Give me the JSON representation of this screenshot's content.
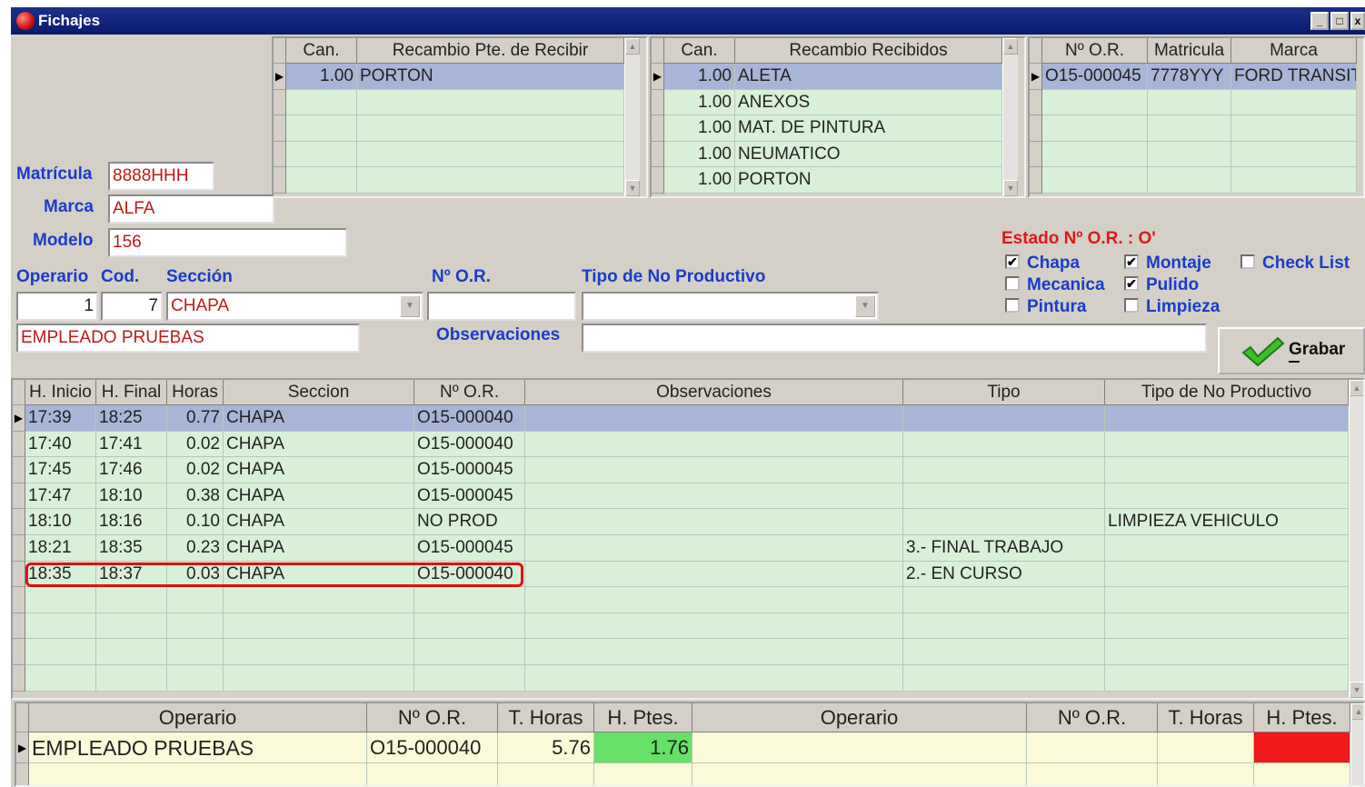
{
  "window": {
    "title": "Fichajes"
  },
  "pending_grid": {
    "headers": [
      "Can.",
      "Recambio Pte. de Recibir"
    ],
    "rows": [
      [
        "1.00",
        "PORTON"
      ]
    ]
  },
  "received_grid": {
    "headers": [
      "Can.",
      "Recambio Recibidos"
    ],
    "rows": [
      [
        "1.00",
        "ALETA"
      ],
      [
        "1.00",
        "ANEXOS"
      ],
      [
        "1.00",
        "MAT. DE PINTURA"
      ],
      [
        "1.00",
        "NEUMATICO"
      ],
      [
        "1.00",
        "PORTON"
      ]
    ]
  },
  "orders_grid": {
    "headers": [
      "Nº O.R.",
      "Matricula",
      "Marca"
    ],
    "rows": [
      [
        "O15-000045",
        "7778YYY",
        "FORD TRANSIT"
      ]
    ]
  },
  "form": {
    "matricula_label": "Matrícula",
    "matricula": "8888HHH",
    "marca_label": "Marca",
    "marca": "ALFA",
    "modelo_label": "Modelo",
    "modelo": "156",
    "operario_label": "Operario",
    "operario": "1",
    "cod_label": "Cod.",
    "cod": "7",
    "seccion_label": "Sección",
    "seccion": "CHAPA",
    "nor_label": "Nº O.R.",
    "nor": "",
    "tipo_label": "Tipo de No Productivo",
    "tipo": "",
    "empleado": "EMPLEADO PRUEBAS",
    "observaciones_label": "Observaciones",
    "observaciones": ""
  },
  "estado": {
    "title": "Estado Nº O.R. : O'",
    "checks": [
      {
        "label": "Chapa",
        "checked": true
      },
      {
        "label": "Montaje",
        "checked": true
      },
      {
        "label": "Check List",
        "checked": false
      },
      {
        "label": "Mecanica",
        "checked": false
      },
      {
        "label": "Pulido",
        "checked": true
      },
      {
        "label": "Pintura",
        "checked": false
      },
      {
        "label": "Limpieza",
        "checked": false
      }
    ]
  },
  "grabar_button": {
    "label": "Grabar"
  },
  "fichajes_grid": {
    "headers": [
      "H. Inicio",
      "H. Final",
      "Horas",
      "Seccion",
      "Nº O.R.",
      "Observaciones",
      "Tipo",
      "Tipo de No Productivo"
    ],
    "rows": [
      [
        "17:39",
        "18:25",
        "0.77",
        "CHAPA",
        "O15-000040",
        "",
        "",
        ""
      ],
      [
        "17:40",
        "17:41",
        "0.02",
        "CHAPA",
        "O15-000040",
        "",
        "",
        ""
      ],
      [
        "17:45",
        "17:46",
        "0.02",
        "CHAPA",
        "O15-000045",
        "",
        "",
        ""
      ],
      [
        "17:47",
        "18:10",
        "0.38",
        "CHAPA",
        "O15-000045",
        "",
        "",
        ""
      ],
      [
        "18:10",
        "18:16",
        "0.10",
        "CHAPA",
        "NO PROD",
        "",
        "",
        "LIMPIEZA VEHICULO"
      ],
      [
        "18:21",
        "18:35",
        "0.23",
        "CHAPA",
        "O15-000045",
        "",
        "3.- FINAL TRABAJO",
        ""
      ],
      [
        "18:35",
        "18:37",
        "0.03",
        "CHAPA",
        "O15-000040",
        "",
        "2.- EN CURSO",
        ""
      ]
    ]
  },
  "summary_grid": {
    "headers": [
      "Operario",
      "Nº O.R.",
      "T. Horas",
      "H. Ptes.",
      "Operario",
      "Nº O.R.",
      "T. Horas",
      "H. Ptes."
    ],
    "rows": [
      [
        "EMPLEADO PRUEBAS",
        "O15-000040",
        "5.76",
        "1.76",
        "",
        "",
        "",
        ""
      ]
    ],
    "colors": {
      "pending_ok": "#66e066",
      "pending_bad": "#f01818"
    }
  }
}
